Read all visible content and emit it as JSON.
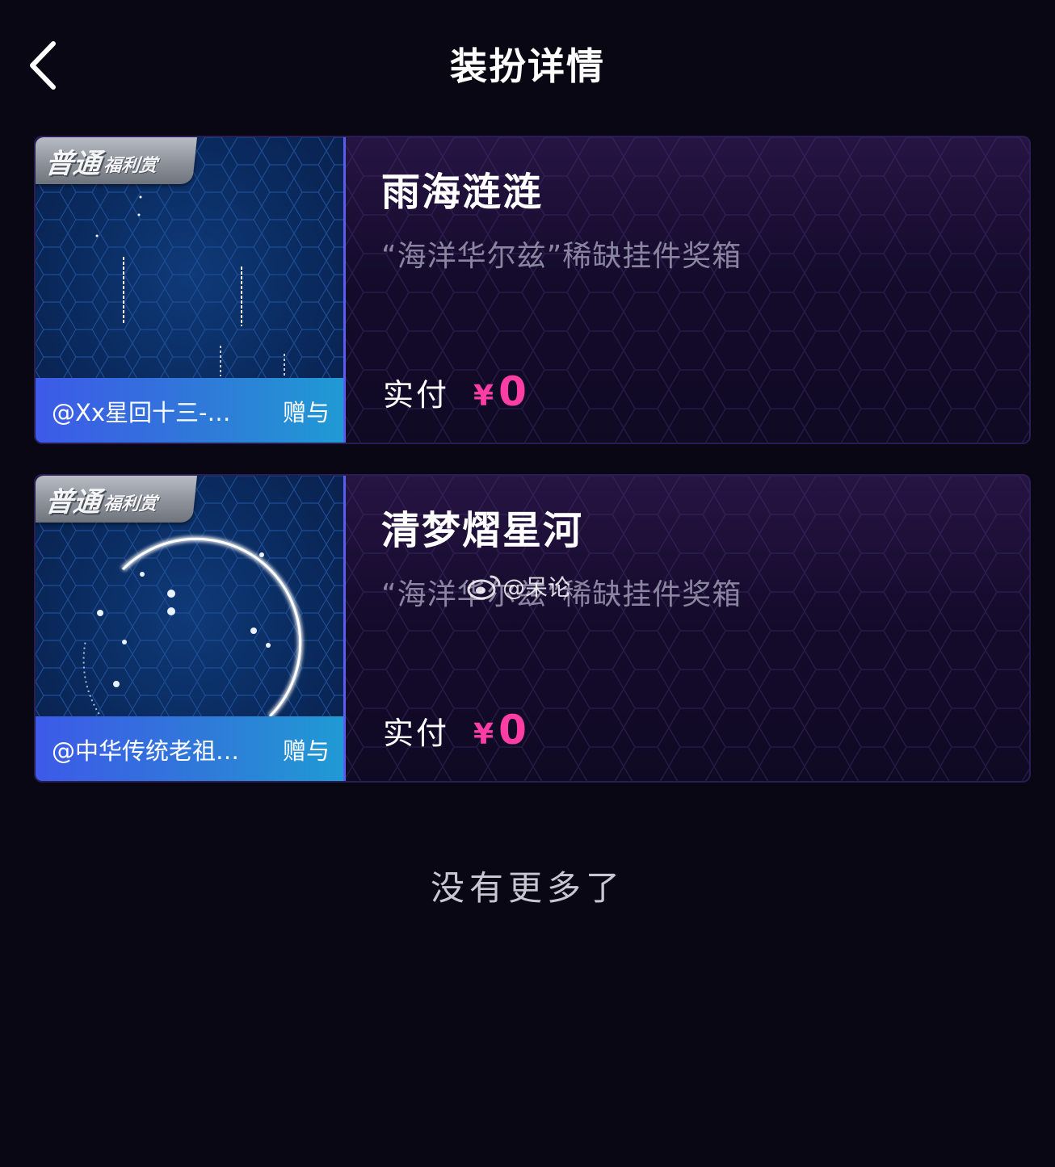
{
  "header": {
    "title": "装扮详情",
    "back_icon": "chevron-left-icon"
  },
  "items": [
    {
      "badge_main": "普通",
      "badge_sub": "福利赏",
      "gift_user": "@Xx星回十三-…",
      "gift_label": "赠与",
      "name": "雨海涟涟",
      "source": "“海洋华尔兹”稀缺挂件奖箱",
      "price_label": "实付",
      "price_currency": "¥",
      "price_value": "0"
    },
    {
      "badge_main": "普通",
      "badge_sub": "福利赏",
      "gift_user": "@中华传统老祖…",
      "gift_label": "赠与",
      "name": "清梦熠星河",
      "source": "“海洋华尔兹”稀缺挂件奖箱",
      "price_label": "实付",
      "price_currency": "¥",
      "price_value": "0"
    }
  ],
  "footer": {
    "text": "没有更多了"
  },
  "watermark": {
    "text": "@呆论",
    "icon": "weibo-icon"
  },
  "colors": {
    "background": "#0a0714",
    "price": "#ff3ea5",
    "gift_bar": "#2f7ad8"
  }
}
